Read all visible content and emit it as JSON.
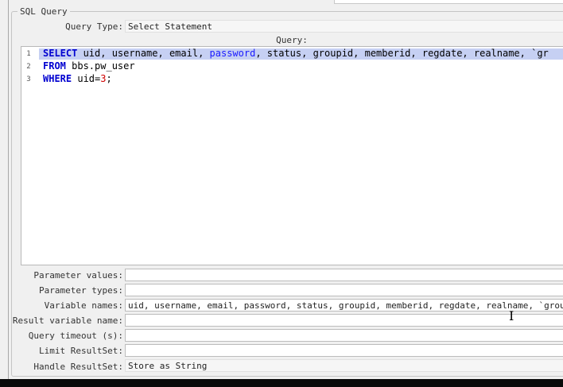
{
  "group": {
    "legend": "SQL Query"
  },
  "query_type": {
    "label": "Query Type:",
    "value": "Select Statement"
  },
  "query": {
    "label": "Query:",
    "lines": [
      {
        "n": "1",
        "kw": "SELECT",
        "rest_a": " uid, username, email, ",
        "kw2": "password",
        "rest_b": ", status, groupid, memberid, regdate, realname, `gr"
      },
      {
        "n": "2",
        "kw": "FROM",
        "rest": " bbs.pw_user"
      },
      {
        "n": "3",
        "kw": "WHERE",
        "rest": " uid=",
        "num": "3",
        "tail": ";"
      }
    ]
  },
  "params": {
    "parameter_values": {
      "label": "Parameter values:",
      "value": ""
    },
    "parameter_types": {
      "label": "Parameter types:",
      "value": ""
    },
    "variable_names": {
      "label": "Variable names:",
      "value": "uid, username, email, password, status, groupid, memberid, regdate, realname, `groups"
    },
    "result_variable_name": {
      "label": "Result variable name:",
      "value": ""
    },
    "query_timeout": {
      "label": "Query timeout (s):",
      "value": ""
    },
    "limit_resultset": {
      "label": "Limit ResultSet:",
      "value": ""
    },
    "handle_resultset": {
      "label": "Handle ResultSet:",
      "value": "Store as String"
    }
  },
  "cursor_icon": "text-cursor-icon"
}
